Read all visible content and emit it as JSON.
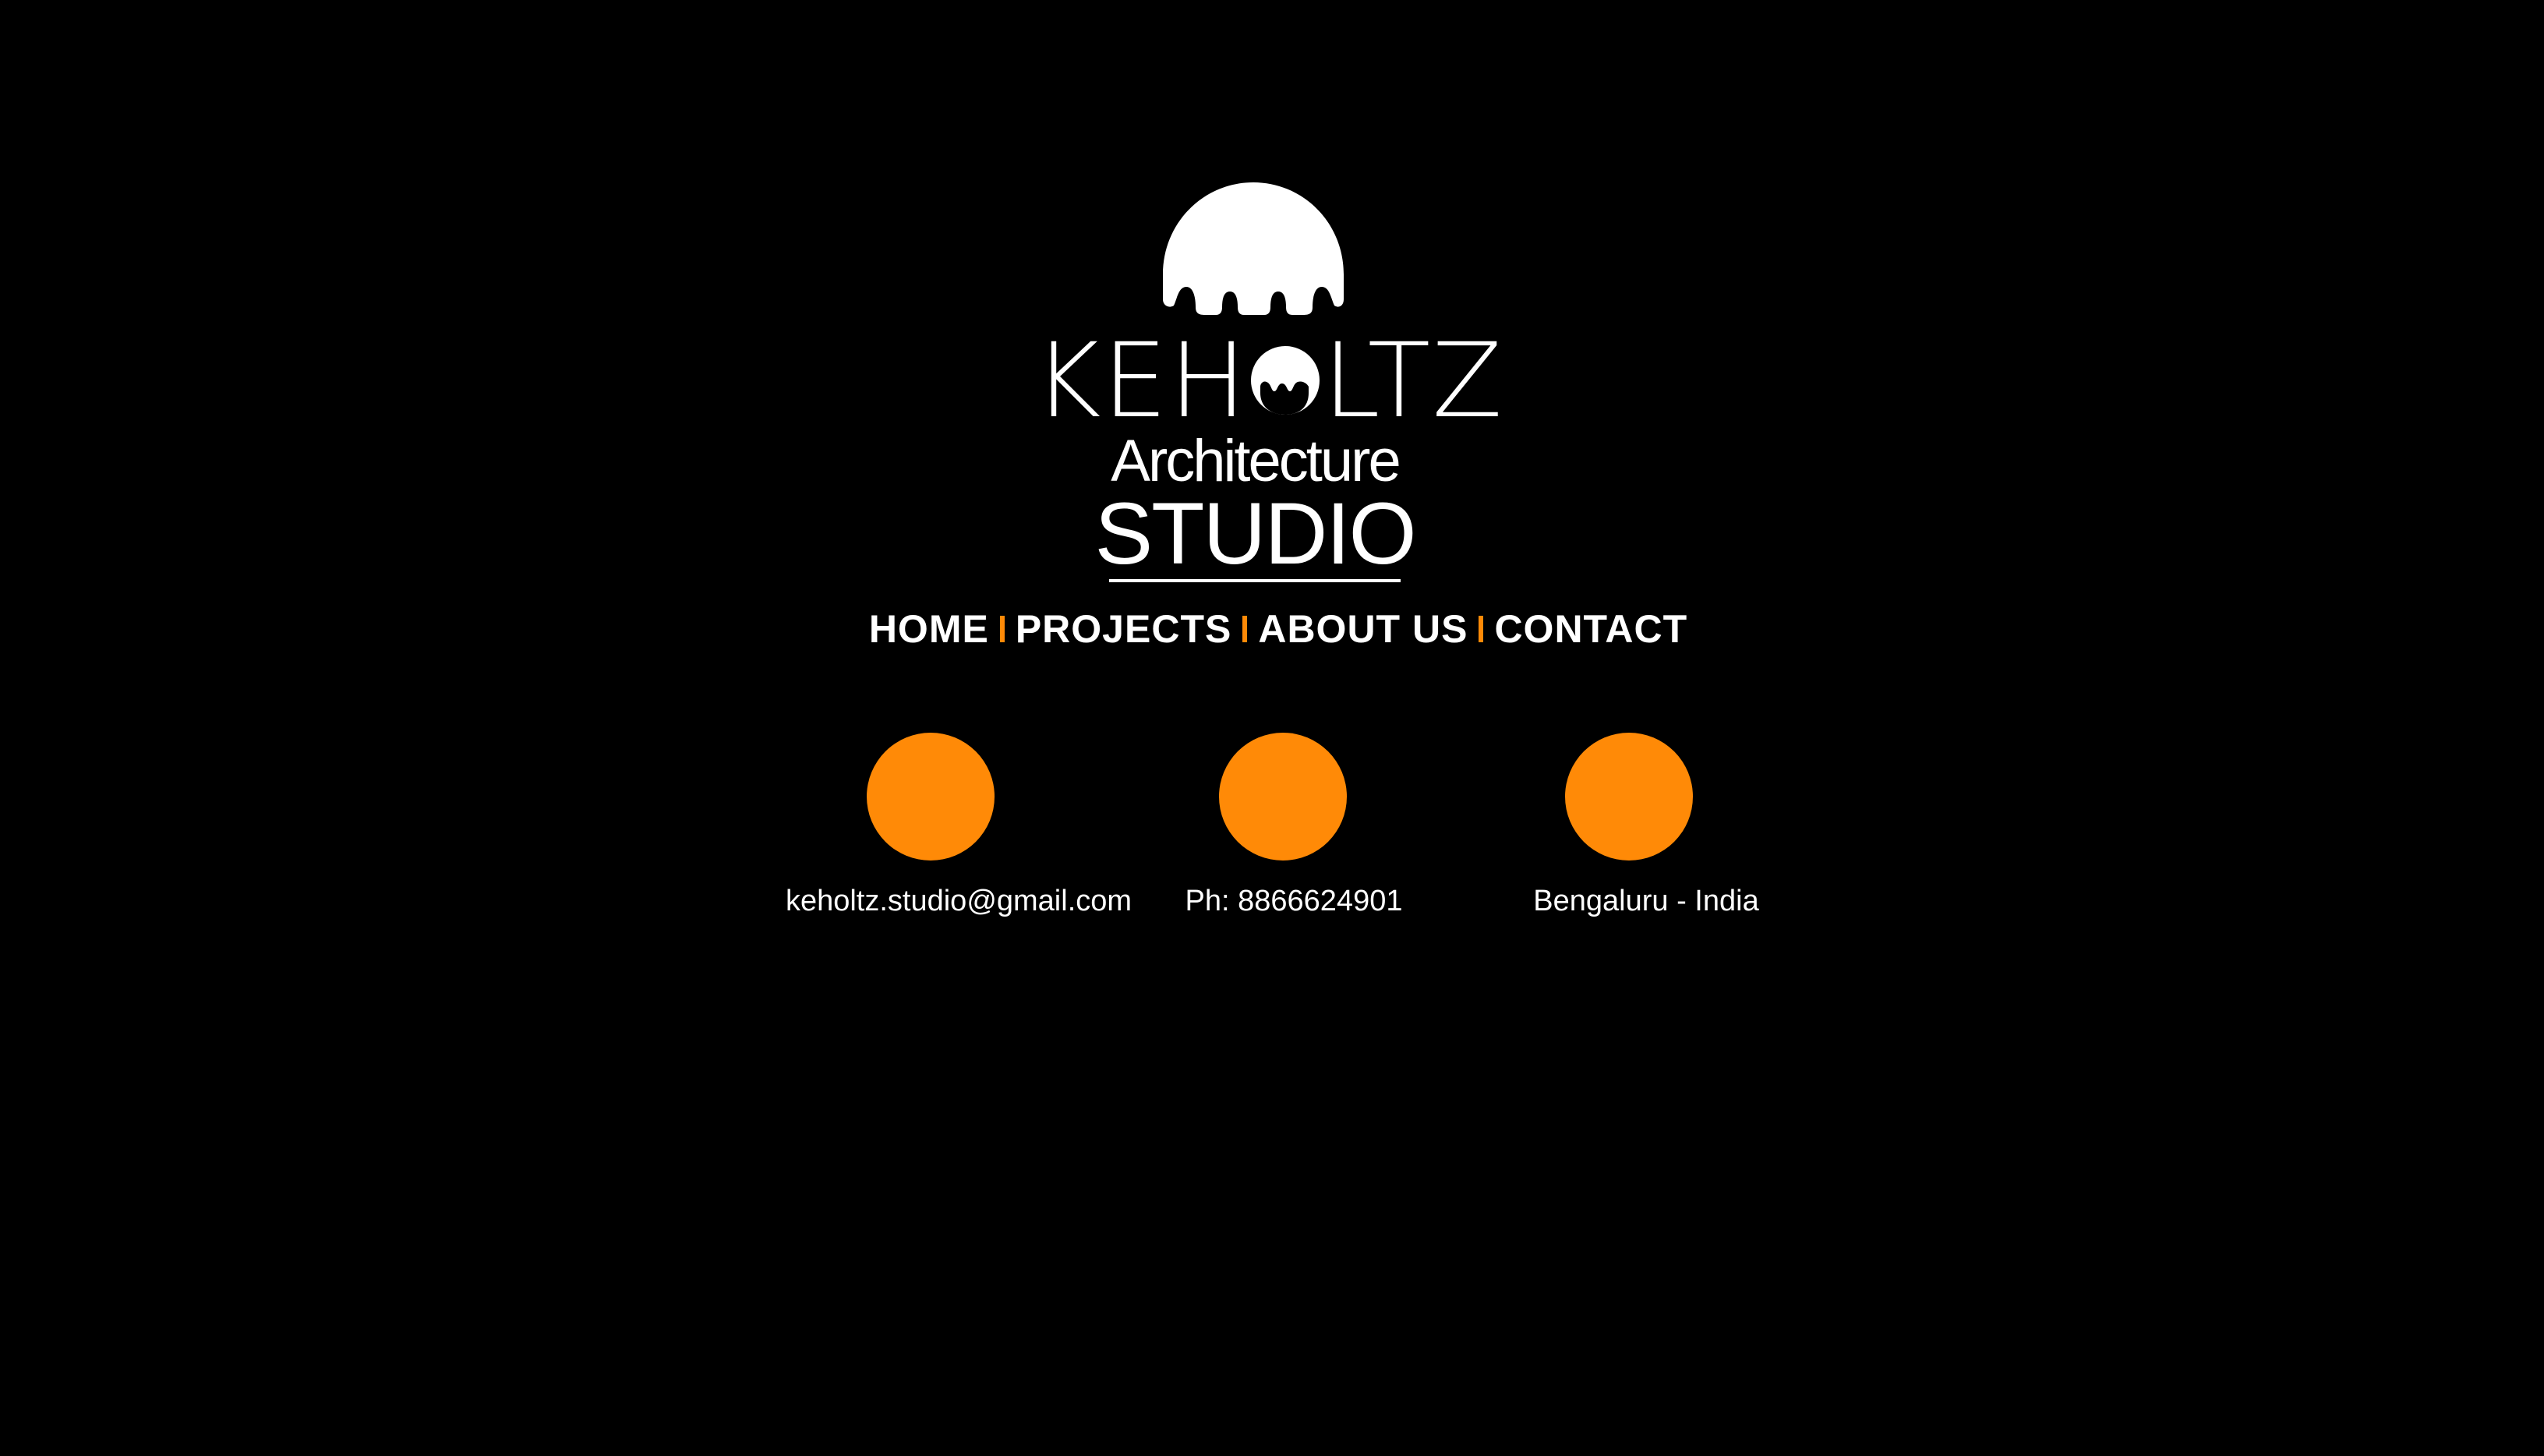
{
  "brand": {
    "logo_icon": "elephant-dome-icon",
    "word_pre": "KEH",
    "word_post": "LTZ",
    "subtitle": "Architecture",
    "studio": "STUDIO"
  },
  "nav": {
    "items": [
      {
        "label": "HOME"
      },
      {
        "label": "PROJECTS"
      },
      {
        "label": "ABOUT US"
      },
      {
        "label": "CONTACT"
      }
    ],
    "separator": "I"
  },
  "contact": {
    "email": "keholtz.studio@gmail.com",
    "phone": "Ph: 8866624901",
    "location": "Bengaluru - India"
  },
  "colors": {
    "background": "#000000",
    "text": "#ffffff",
    "accent": "#ff8a07"
  }
}
